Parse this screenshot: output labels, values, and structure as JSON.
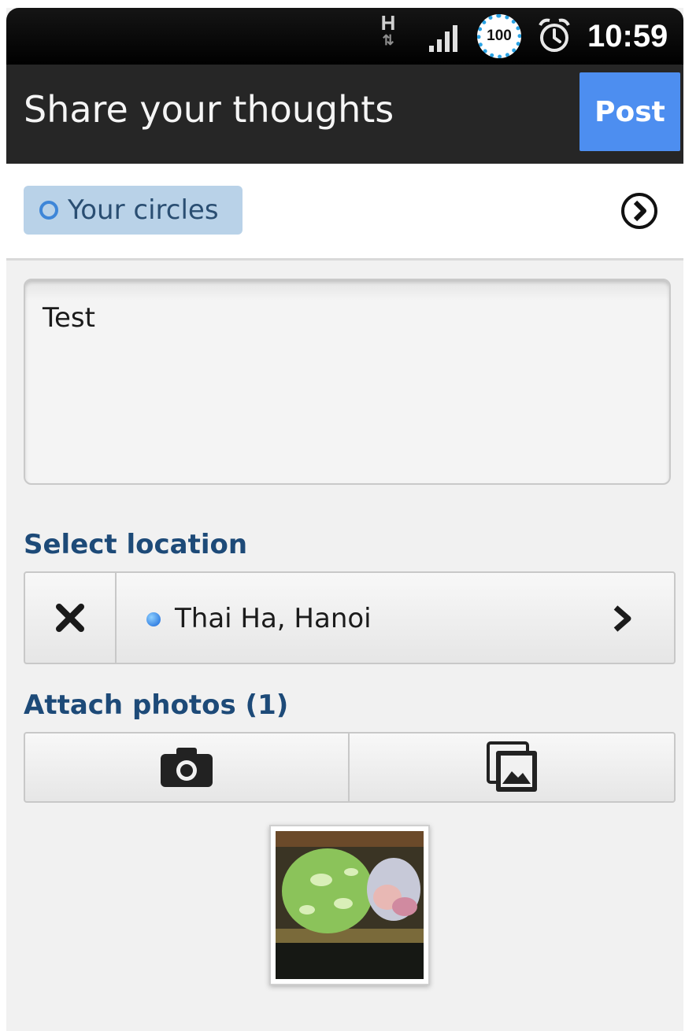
{
  "status_bar": {
    "network_type": "H",
    "battery": "100",
    "time": "10:59"
  },
  "action_bar": {
    "title": "Share your thoughts",
    "post_label": "Post"
  },
  "audience": {
    "label": "Your circles"
  },
  "post": {
    "text": "Test"
  },
  "location": {
    "section_label": "Select location",
    "value": "Thai Ha, Hanoi"
  },
  "photos": {
    "section_label": "Attach photos (1)"
  },
  "colors": {
    "accent": "#4d8ef0",
    "section_label": "#1d4a78",
    "chip_bg": "#b9d2e8"
  }
}
